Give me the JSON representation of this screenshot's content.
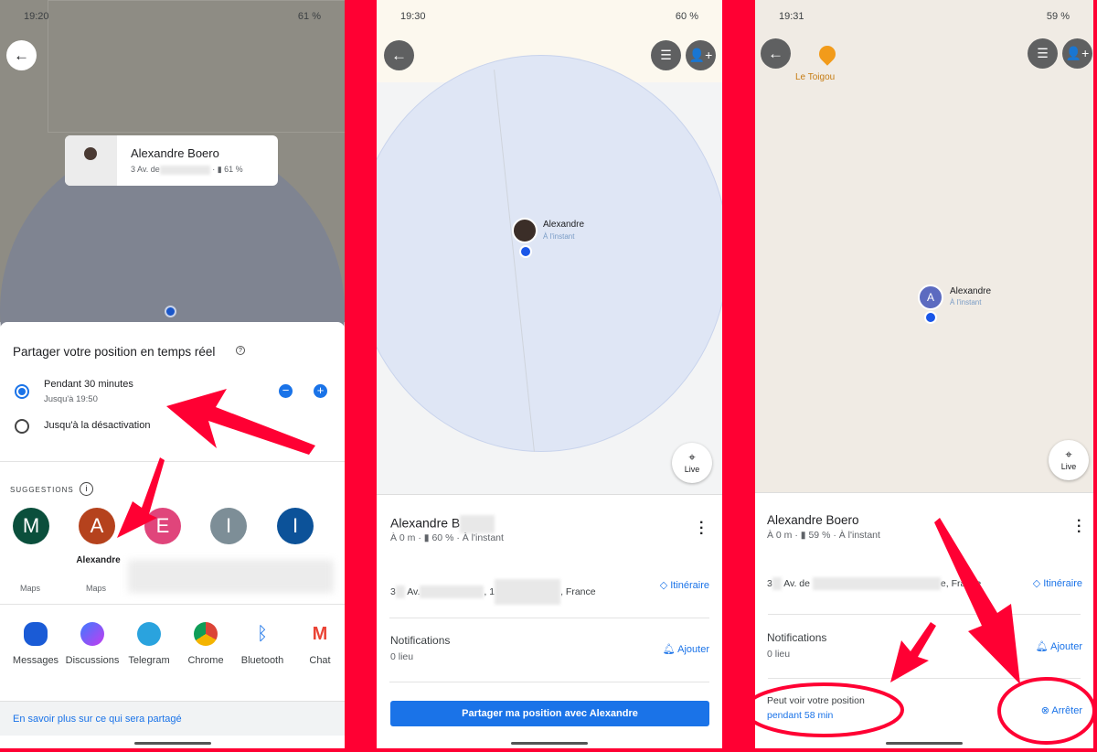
{
  "panel1": {
    "status": {
      "time": "19:20",
      "battery": "61 %"
    },
    "card": {
      "name": "Alexandre Boero",
      "address_prefix": "3",
      "address_street": "Av. de",
      "battery": "61 %"
    },
    "sheet": {
      "title": "Partager votre position en temps réel",
      "options": [
        {
          "label": "Pendant 30 minutes",
          "sub": "Jusqu'à 19:50",
          "selected": true
        },
        {
          "label": "Jusqu'à la désactivation",
          "selected": false
        }
      ],
      "suggestions_label": "SUGGESTIONS",
      "contacts": [
        {
          "initial": "M",
          "color": "#0b4f3c",
          "sub": "Maps"
        },
        {
          "initial": "A",
          "color": "#b5421d",
          "name": "Alexandre",
          "sub": "Maps"
        },
        {
          "initial": "E",
          "color": "#e0457b"
        },
        {
          "initial": "I",
          "color": "#7d8e97"
        },
        {
          "initial": "I",
          "color": "#0c5299"
        }
      ],
      "apps": [
        "Messages",
        "Discussions",
        "Telegram",
        "Chrome",
        "Bluetooth",
        "Chat"
      ],
      "learn_more": "En savoir plus sur ce qui sera partagé"
    }
  },
  "panel2": {
    "status": {
      "time": "19:30",
      "battery": "60 %"
    },
    "marker": {
      "name": "Alexandre",
      "time": "À l'instant"
    },
    "live_label": "Live",
    "info": {
      "name": "Alexandre B",
      "meta_distance": "À 0 m",
      "meta_battery": "60 %",
      "meta_time": "À l'instant",
      "address_a": "3",
      "address_b": "Av.",
      "address_c": ", 1",
      "address_d": ", France",
      "directions": "Itinéraire",
      "notifications": "Notifications",
      "places": "0 lieu",
      "add": "Ajouter",
      "share_button": "Partager ma position avec Alexandre"
    }
  },
  "panel3": {
    "status": {
      "time": "19:31",
      "battery": "59 %"
    },
    "poi": "Le Toigou",
    "marker": {
      "initial": "A",
      "name": "Alexandre",
      "time": "À l'instant"
    },
    "live_label": "Live",
    "info": {
      "name": "Alexandre Boero",
      "meta_distance": "À 0 m",
      "meta_battery": "59 %",
      "meta_time": "À l'instant",
      "address_a": "3",
      "address_b": "Av. de",
      "address_d": "e, France",
      "directions": "Itinéraire",
      "notifications": "Notifications",
      "places": "0 lieu",
      "add": "Ajouter",
      "can_see": "Peut voir votre position",
      "duration": "pendant 58 min",
      "stop": "Arrêter"
    }
  },
  "colors": {
    "accent": "#1a73e8",
    "annotation": "#ff0033"
  }
}
